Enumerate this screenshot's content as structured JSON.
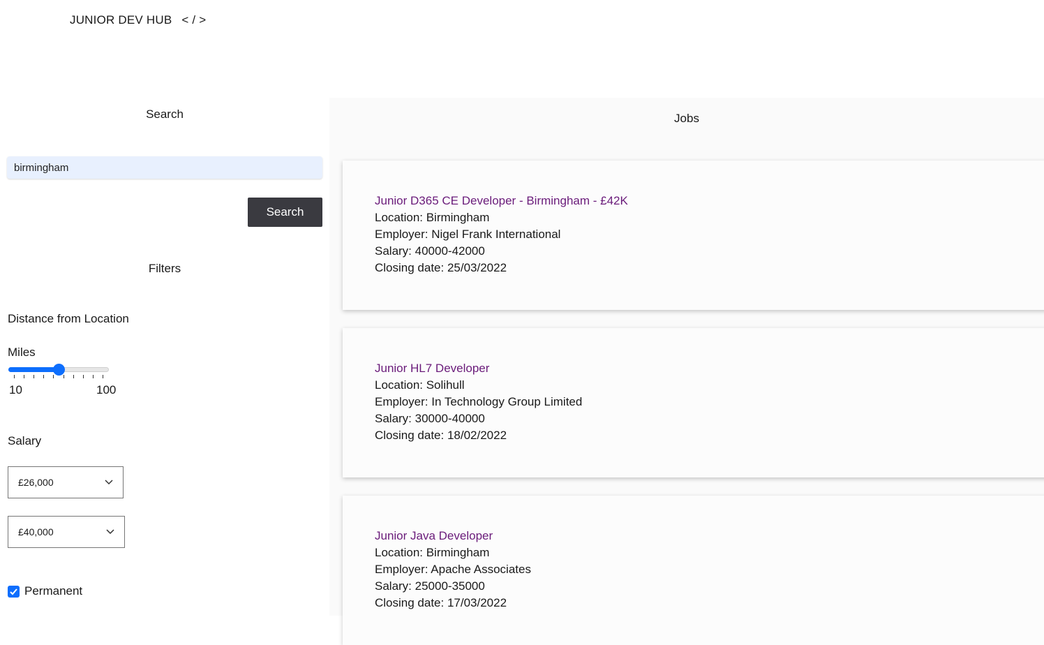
{
  "header": {
    "brand": "JUNIOR DEV HUB",
    "code": "< / >"
  },
  "sidebar": {
    "search_heading": "Search",
    "search_value": "birmingham",
    "search_button": "Search",
    "filters_heading": "Filters",
    "distance_label": "Distance from Location",
    "miles_label": "Miles",
    "slider": {
      "min_label": "10",
      "max_label": "100",
      "value_fraction": 0.5
    },
    "salary_label": "Salary",
    "salary_min": "£26,000",
    "salary_max": "£40,000",
    "permanent_label": "Permanent",
    "permanent_checked": true
  },
  "jobs": {
    "heading": "Jobs",
    "items": [
      {
        "title": "Junior D365 CE Developer - Birmingham - £42K",
        "location": "Location: Birmingham",
        "employer": "Employer: Nigel Frank International",
        "salary": "Salary: 40000-42000",
        "closing": "Closing date: 25/03/2022"
      },
      {
        "title": "Junior HL7 Developer",
        "location": "Location: Solihull",
        "employer": "Employer: In Technology Group Limited",
        "salary": "Salary: 30000-40000",
        "closing": "Closing date: 18/02/2022"
      },
      {
        "title": "Junior Java Developer",
        "location": "Location: Birmingham",
        "employer": "Employer: Apache Associates",
        "salary": "Salary: 25000-35000",
        "closing": "Closing date: 17/03/2022"
      }
    ]
  },
  "colors": {
    "accent": "#0d6efd",
    "job_title": "#6a1b7a",
    "button": "#3a3a40"
  }
}
